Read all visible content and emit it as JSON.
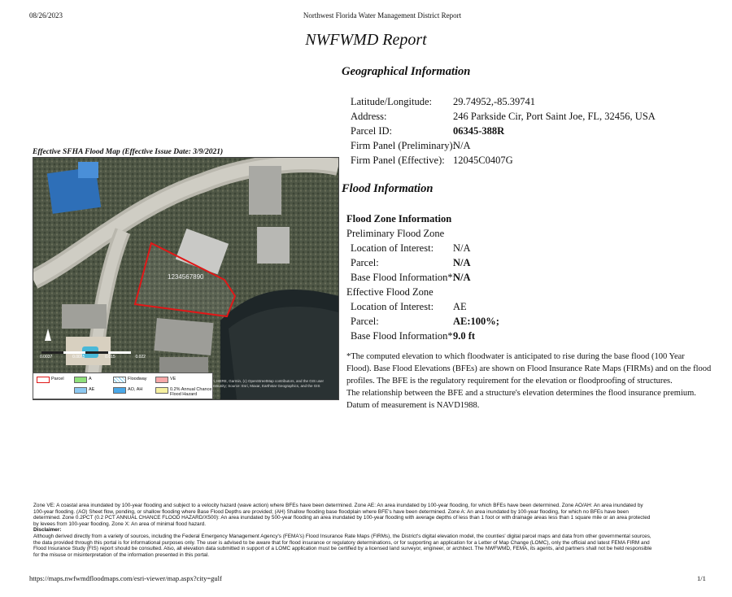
{
  "header": {
    "date": "08/26/2023",
    "center_title": "Northwest Florida Water Management District Report"
  },
  "report_title": "NWFWMD Report",
  "geo": {
    "heading": "Geographical Information",
    "rows": [
      {
        "label": "Latitude/Longitude:",
        "value": "29.74952,-85.39741"
      },
      {
        "label": "Address:",
        "value": "246 Parkside Cir, Port Saint Joe, FL, 32456, USA"
      },
      {
        "label": "Parcel ID:",
        "value": "06345-388R"
      },
      {
        "label": "Firm Panel (Preliminary):",
        "value": "N/A"
      },
      {
        "label": "Firm Panel (Effective):",
        "value": "12045C0407G"
      }
    ]
  },
  "map": {
    "caption": "Effective SFHA Flood Map (Effective Issue Date: 3/9/2021)",
    "parcel_label": "1234567890",
    "scale_labels": [
      "0.0037",
      "0.0075",
      "0.015",
      "0.022"
    ],
    "attribution": "Esri, HERE, Garmin, (c) OpenStreetMap contributors, and the GIS user community; Source: Esri, Maxar, Earthstar Geographics, and the GIS",
    "legend": [
      {
        "label": "Parcel",
        "color": "#f4b8b8"
      },
      {
        "label": "A",
        "color": "#8fe07a"
      },
      {
        "label": "Floodway",
        "color": "#ffffff"
      },
      {
        "label": "VE",
        "color": "#f7a8a8"
      },
      {
        "label": "AE",
        "color": "#8cc8f0"
      },
      {
        "label": "AO, AH",
        "color": "#4aa8e8"
      },
      {
        "label": "0.2% Annual Chance Flood Hazard",
        "color": "#f6f0a0"
      }
    ]
  },
  "flood": {
    "heading": "Flood Information",
    "zone_info": "Flood Zone Information",
    "preliminary": "Preliminary Flood Zone",
    "preliminary_rows": [
      {
        "label": "Location of Interest:",
        "value": "N/A"
      },
      {
        "label": "Parcel:",
        "value": "N/A"
      },
      {
        "label": "Base Flood Information*:",
        "value": "N/A"
      }
    ],
    "effective": "Effective Flood Zone",
    "effective_rows": [
      {
        "label": "Location of Interest:",
        "value": "AE"
      },
      {
        "label": "Parcel:",
        "value": "AE:100%;"
      },
      {
        "label": "Base Flood Information*:",
        "value": "9.0 ft"
      }
    ],
    "note_lines": [
      "*The computed elevation to which floodwater is anticipated to rise during the base flood (100 Year",
      "Flood). Base Flood Elevations (BFEs) are shown on Flood Insurance Rate Maps (FIRMs) and on the flood",
      "profiles. The BFE is the regulatory requirement for the elevation or floodproofing of structures.",
      "The relationship between the BFE and a structure's elevation determines the flood insurance premium.",
      "Datum of measurement is NAVD1988."
    ]
  },
  "footer": {
    "zone_lines": [
      "Zone VE: A coastal area inundated by 100-year flooding and subject to a velocity hazard (wave action) where BFEs have been determined. Zone AE: An area inundated by 100-year flooding, for which BFEs have been determined. Zone AO/AH: An area inundated by",
      "100-year flooding. (AO) Sheet flow, ponding, or shallow flooding where Base Flood Depths are provided; (AH) Shallow flooding base floodplain where BFE's have been determined. Zone A: An area inundated by 100-year flooding, for which no BFEs have been",
      "determined. Zone 0.2PCT (0.2 PCT ANNUAL CHANCE FLOOD HAZARD/X500): An area inundated by 500-year flooding an area inundated by 100-year flooding with average depths of less than 1 foot or with drainage areas less than 1 square mile or an area protected",
      "by levees from 100-year flooding. Zone X: An area of minimal flood hazard."
    ],
    "disclaimer_title": "Disclaimer:",
    "disclaimer_lines": [
      "Although derived directly from a variety of sources, including the Federal Emergency Management Agency's (FEMA's) Flood Insurance Rate Maps (FIRMs), the District's digital elevation model, the counties' digital parcel maps and data from other governmental sources,",
      "the data provided through this portal is for informational purposes only. The user is advised to be aware that for flood insurance or regulatory determinations, or for supporting an application for a Letter of Map Change (LOMC), only the official and latest FEMA FIRM and",
      "Flood Insurance Study (FIS) report should be consulted. Also, all elevation data submitted in support of a LOMC application must be certified by a licensed land surveyor, engineer, or architect. The NWFWMD, FEMA, its agents, and partners shall not be held responsible",
      "for the misuse or misinterpretation of the information presented in this portal."
    ],
    "url": "https://maps.nwfwmdfloodmaps.com/esri-viewer/map.aspx?city=gulf",
    "page": "1/1"
  }
}
